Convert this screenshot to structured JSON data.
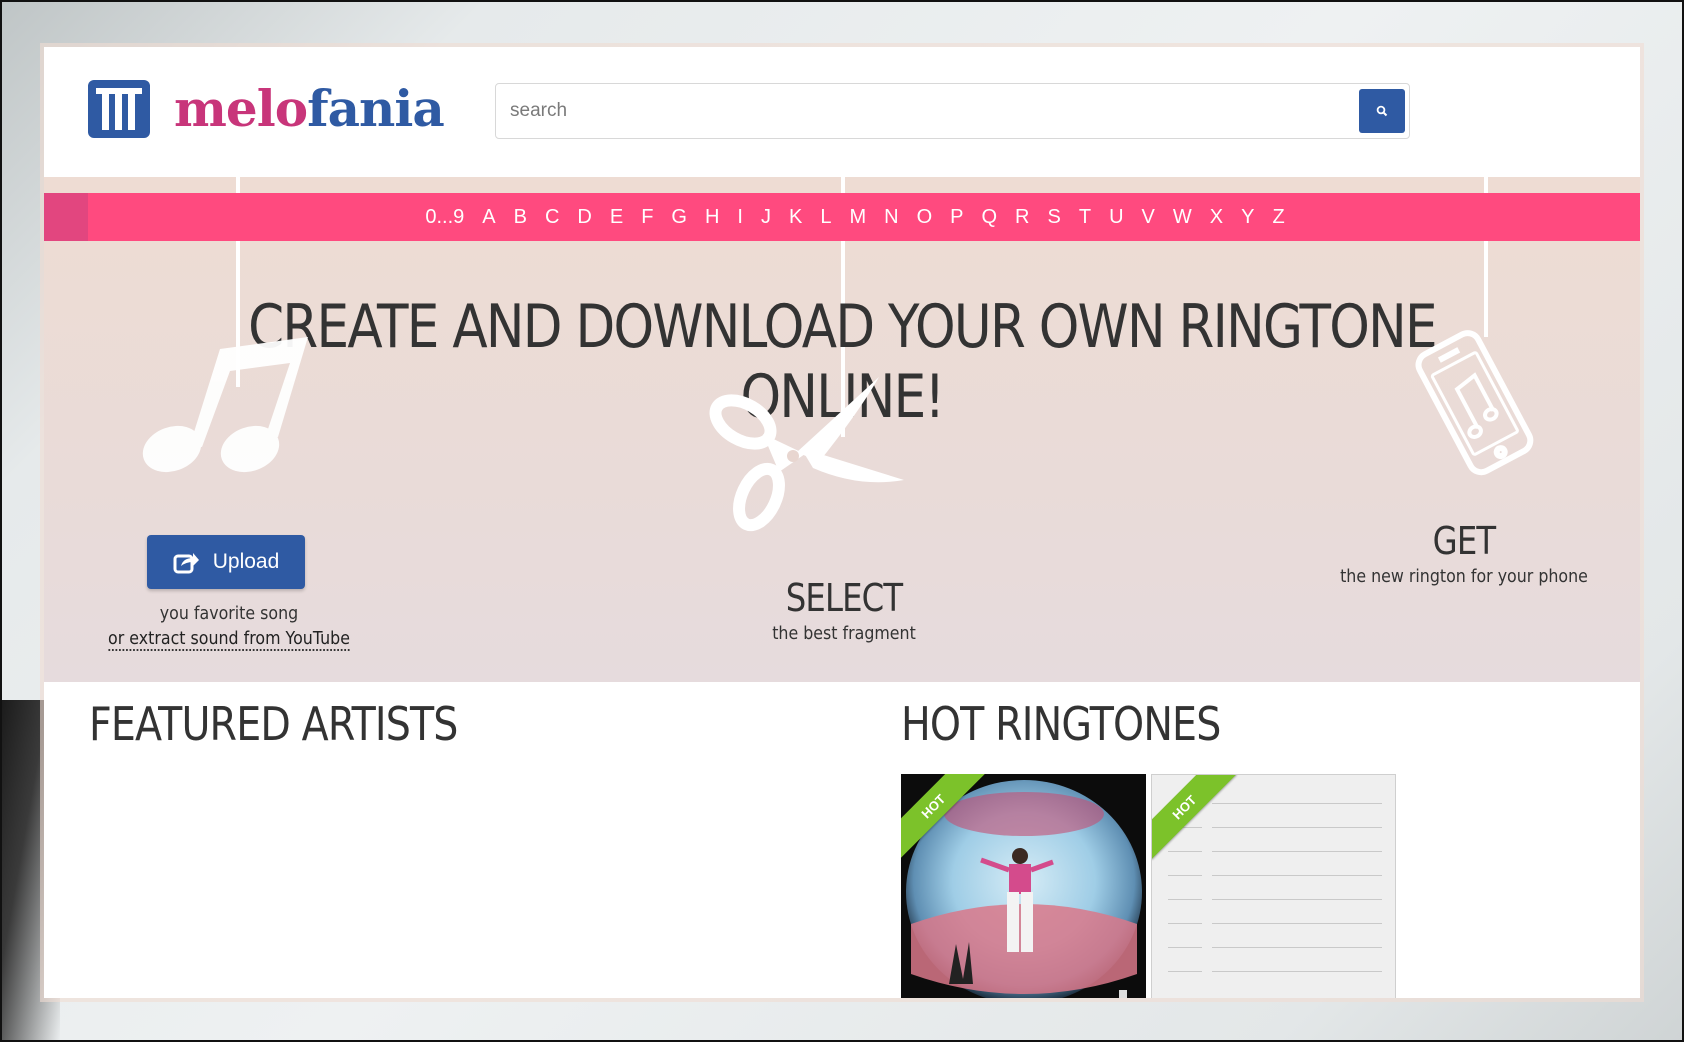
{
  "header": {
    "logo_part1": "melo",
    "logo_part2": "fania",
    "search_placeholder": "search"
  },
  "alphabet": [
    "0...9",
    "A",
    "B",
    "C",
    "D",
    "E",
    "F",
    "G",
    "H",
    "I",
    "J",
    "K",
    "L",
    "M",
    "N",
    "O",
    "P",
    "Q",
    "R",
    "S",
    "T",
    "U",
    "V",
    "W",
    "X",
    "Y",
    "Z"
  ],
  "hero": {
    "title": "CREATE AND DOWNLOAD YOUR OWN RINGTONE ONLINE!",
    "upload_label": "Upload",
    "upload_caption": "you favorite song",
    "youtube_link": "or extract sound from YouTube",
    "select_title": "SELECT",
    "select_caption": "the best fragment",
    "get_title": "GET",
    "get_caption": "the new rington for your phone"
  },
  "sections": {
    "featured_artists": "FEATURED ARTISTS",
    "hot_ringtones": "HOT RINGTONES"
  },
  "hot_cards": [
    {
      "badge": "HOT"
    },
    {
      "badge": "HOT"
    }
  ],
  "colors": {
    "brand_blue": "#2f5aa3",
    "brand_pink": "#c8357a",
    "alpha_bar": "#ff4a7f",
    "hot_green": "#7cc22a"
  },
  "icons": [
    "music-notes-icon",
    "scissors-icon",
    "phone-icon",
    "share-icon",
    "search-icon"
  ]
}
